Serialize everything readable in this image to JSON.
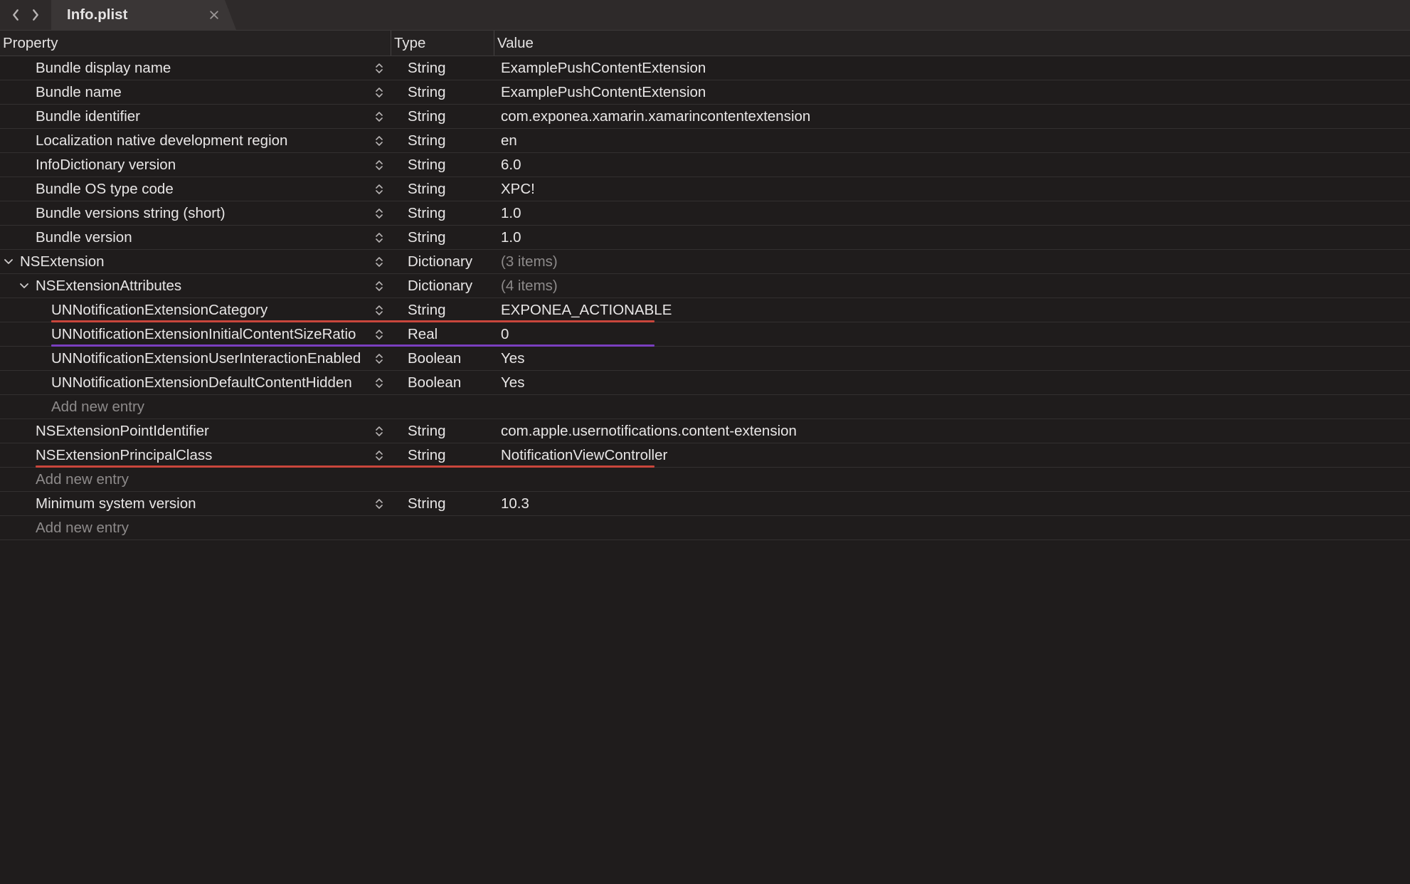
{
  "tab": {
    "title": "Info.plist"
  },
  "columns": {
    "property": "Property",
    "type": "Type",
    "value": "Value"
  },
  "add_new_entry": "Add new entry",
  "underline_colors": {
    "red": "#c9463c",
    "purple": "#7a3fbf"
  },
  "rows": [
    {
      "indent": 1,
      "expand": null,
      "key": "Bundle display name",
      "type": "String",
      "value": "ExamplePushContentExtension"
    },
    {
      "indent": 1,
      "expand": null,
      "key": "Bundle name",
      "type": "String",
      "value": "ExamplePushContentExtension"
    },
    {
      "indent": 1,
      "expand": null,
      "key": "Bundle identifier",
      "type": "String",
      "value": "com.exponea.xamarin.xamarincontentextension"
    },
    {
      "indent": 1,
      "expand": null,
      "key": "Localization native development region",
      "type": "String",
      "value": "en"
    },
    {
      "indent": 1,
      "expand": null,
      "key": "InfoDictionary version",
      "type": "String",
      "value": "6.0"
    },
    {
      "indent": 1,
      "expand": null,
      "key": "Bundle OS type code",
      "type": "String",
      "value": "XPC!"
    },
    {
      "indent": 1,
      "expand": null,
      "key": "Bundle versions string (short)",
      "type": "String",
      "value": "1.0"
    },
    {
      "indent": 1,
      "expand": null,
      "key": "Bundle version",
      "type": "String",
      "value": "1.0"
    },
    {
      "indent": 0,
      "expand": "down",
      "key": "NSExtension",
      "type": "Dictionary",
      "value": "(3 items)",
      "dim": true
    },
    {
      "indent": 1,
      "expand": "down",
      "key": "NSExtensionAttributes",
      "type": "Dictionary",
      "value": "(4 items)",
      "dim": true
    },
    {
      "indent": 2,
      "expand": null,
      "key": "UNNotificationExtensionCategory",
      "type": "String",
      "value": "EXPONEA_ACTIONABLE",
      "underline": "red"
    },
    {
      "indent": 2,
      "expand": null,
      "key": "UNNotificationExtensionInitialContentSizeRatio",
      "type": "Real",
      "value": "0",
      "underline": "purple"
    },
    {
      "indent": 2,
      "expand": null,
      "key": "UNNotificationExtensionUserInteractionEnabled",
      "type": "Boolean",
      "value": "Yes"
    },
    {
      "indent": 2,
      "expand": null,
      "key": "UNNotificationExtensionDefaultContentHidden",
      "type": "Boolean",
      "value": "Yes"
    },
    {
      "indent": 2,
      "expand": null,
      "key": "__ADD__",
      "placeholder": true
    },
    {
      "indent": 1,
      "expand": null,
      "key": "NSExtensionPointIdentifier",
      "type": "String",
      "value": "com.apple.usernotifications.content-extension"
    },
    {
      "indent": 1,
      "expand": null,
      "key": "NSExtensionPrincipalClass",
      "type": "String",
      "value": "NotificationViewController",
      "underline": "red"
    },
    {
      "indent": 1,
      "expand": null,
      "key": "__ADD__",
      "placeholder": true
    },
    {
      "indent": 1,
      "expand": null,
      "key": "Minimum system version",
      "type": "String",
      "value": "10.3"
    },
    {
      "indent": 1,
      "expand": null,
      "key": "__ADD__",
      "placeholder": true
    }
  ]
}
